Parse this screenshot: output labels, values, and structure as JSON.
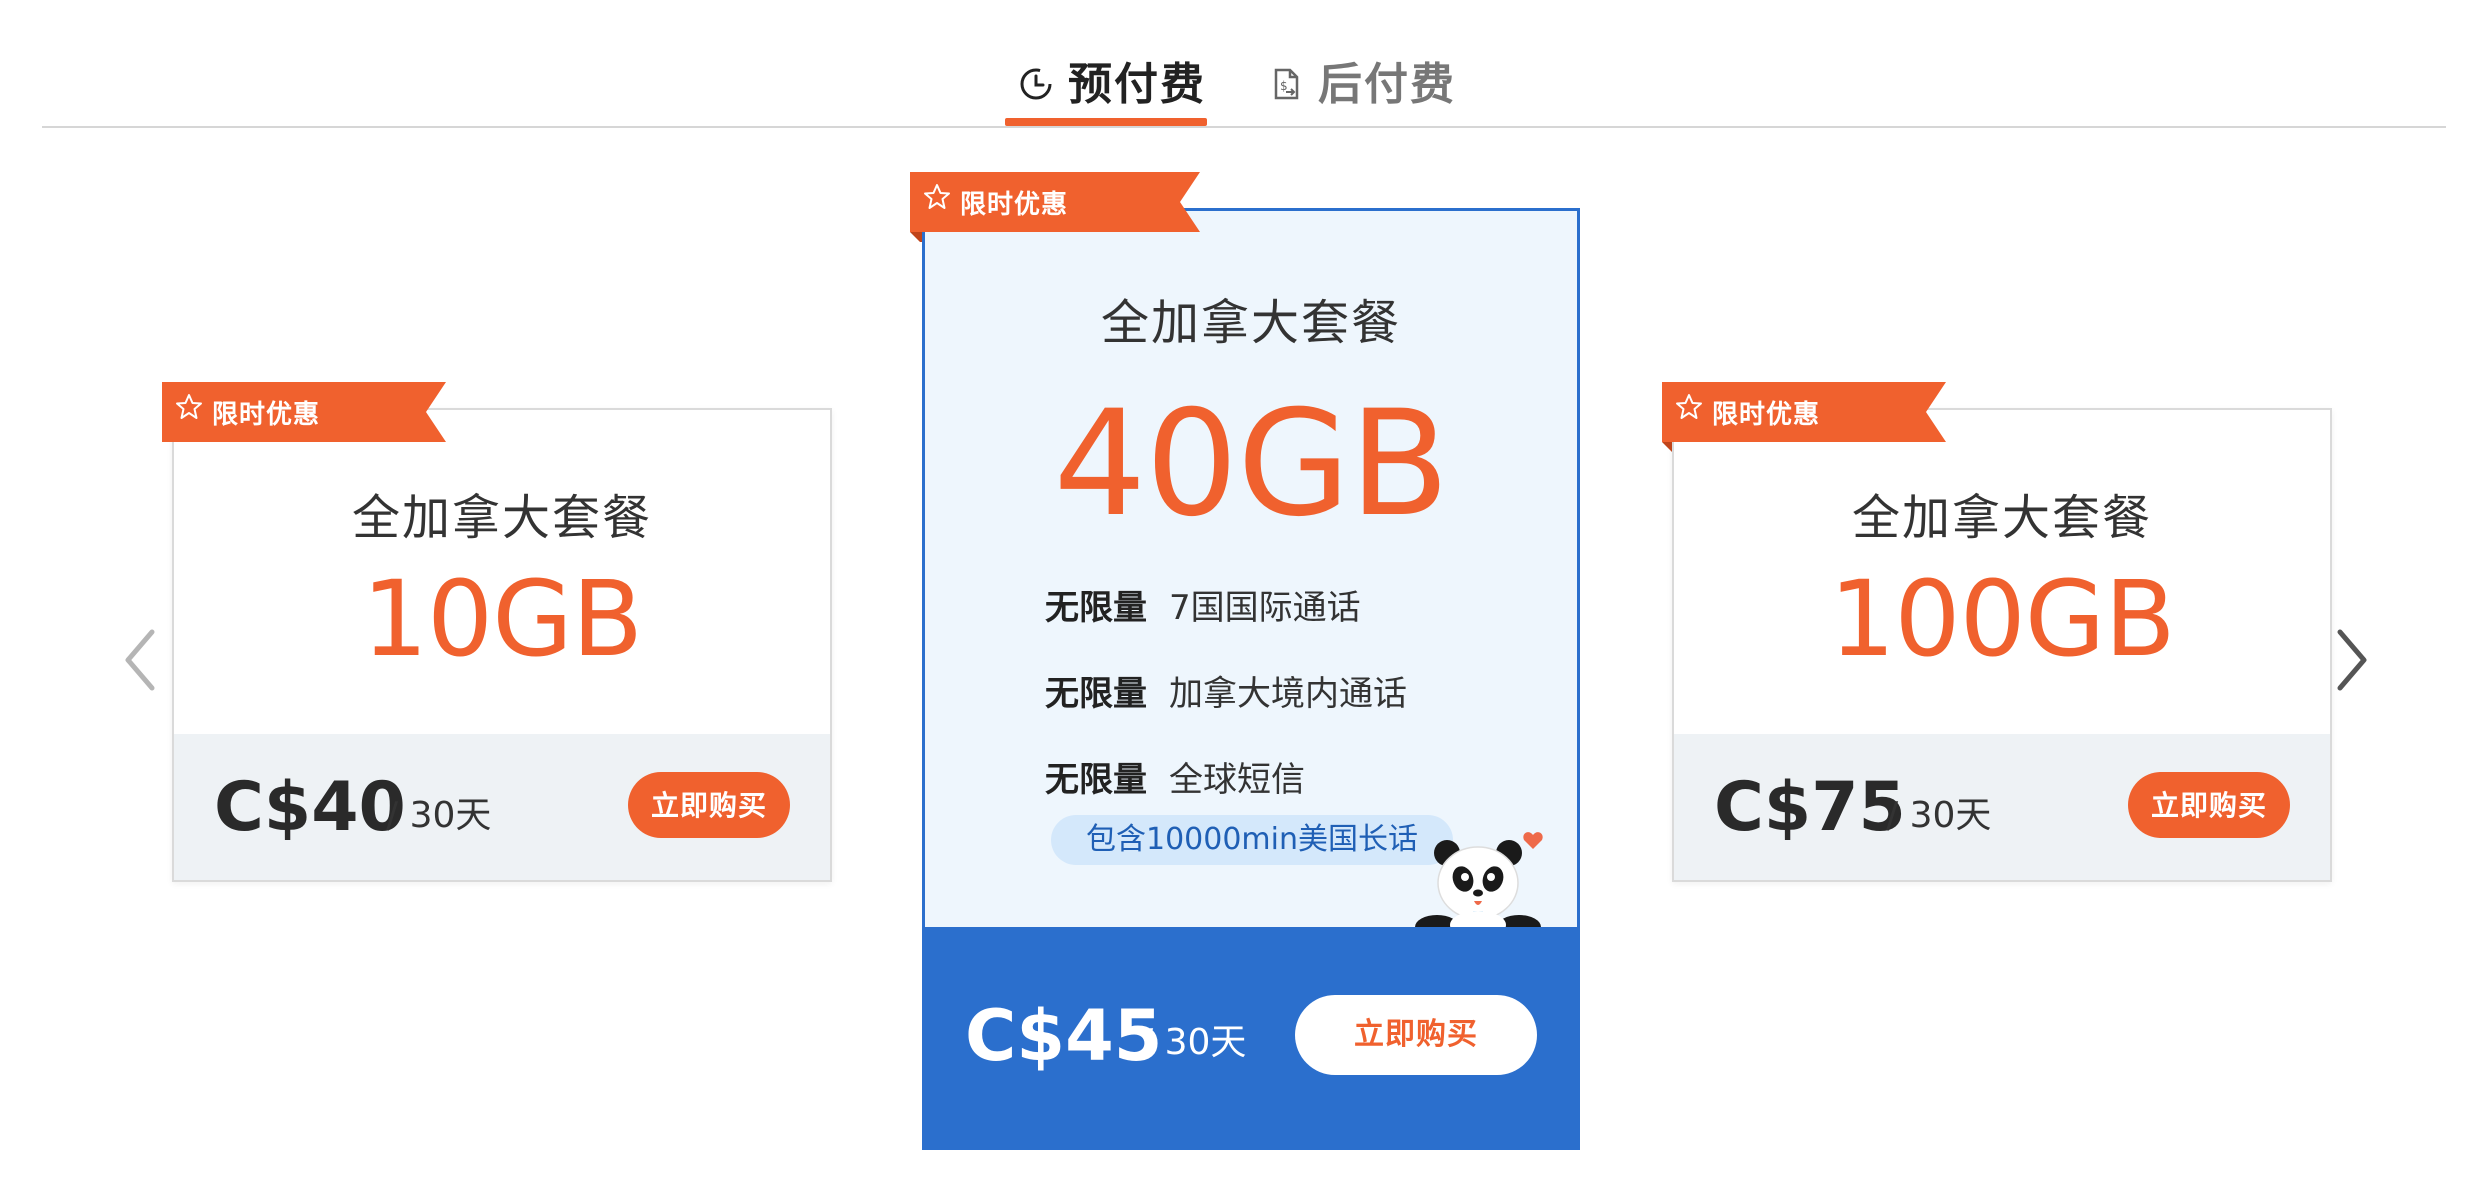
{
  "tabs": [
    {
      "label": "预付费",
      "icon": "clock-icon",
      "active": true
    },
    {
      "label": "后付费",
      "icon": "invoice-icon",
      "active": false
    }
  ],
  "colors": {
    "accent": "#f0612e",
    "featured": "#2b6fcd",
    "footer_gray": "#eef2f5"
  },
  "carousel": {
    "prev_icon": "chevron-left-icon",
    "next_icon": "chevron-right-icon"
  },
  "plans": [
    {
      "ribbon": "限时优惠",
      "name": "全加拿大套餐",
      "data": "10GB",
      "price": "C$40",
      "period": "/ 30天",
      "buy_label": "立即购买",
      "featured": false
    },
    {
      "ribbon": "限时优惠",
      "name": "全加拿大套餐",
      "data": "40GB",
      "features": [
        {
          "tag": "无限量",
          "text": "7国国际通话"
        },
        {
          "tag": "无限量",
          "text": "加拿大境内通话"
        },
        {
          "tag": "无限量",
          "text": "全球短信"
        }
      ],
      "extra": "包含10000min美国长话",
      "mascot": "panda-icon",
      "price": "C$45",
      "period": "/ 30天",
      "buy_label": "立即购买",
      "featured": true
    },
    {
      "ribbon": "限时优惠",
      "name": "全加拿大套餐",
      "data": "100GB",
      "price": "C$75",
      "period": "/ 30天",
      "buy_label": "立即购买",
      "featured": false
    }
  ]
}
